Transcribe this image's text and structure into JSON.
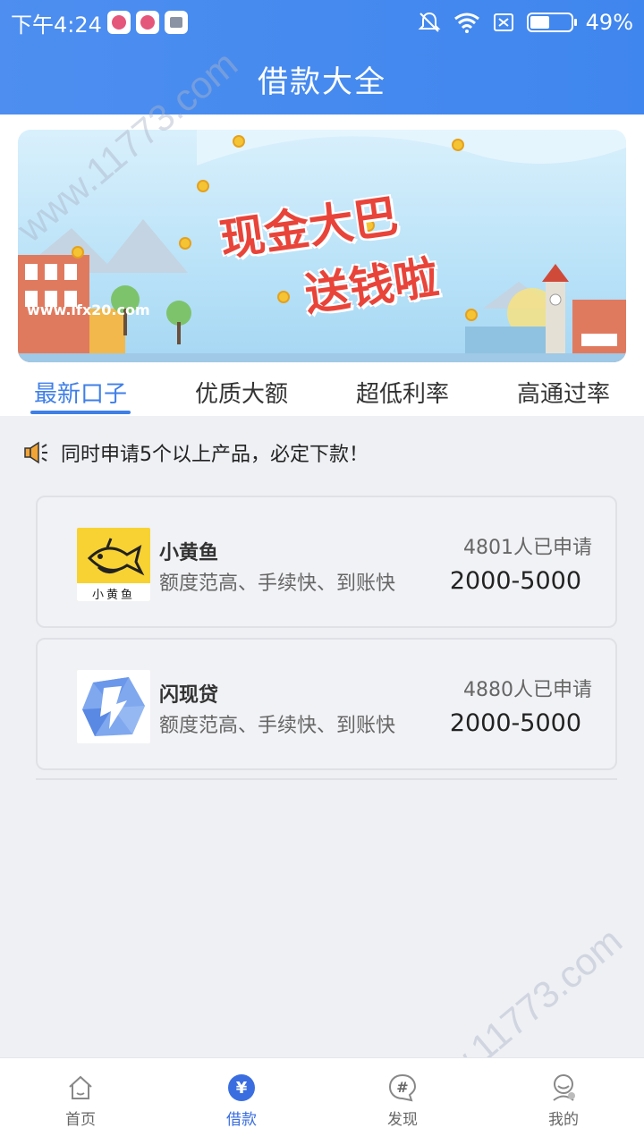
{
  "status_bar": {
    "time": "下午4:24",
    "battery": "49%",
    "battery_level": 0.49
  },
  "header": {
    "title": "借款大全"
  },
  "banner": {
    "headline_1": "现金大巴",
    "headline_2": "送钱啦",
    "url_text": "www.lfx20.com"
  },
  "tabs": [
    {
      "label": "最新口子",
      "active": true
    },
    {
      "label": "优质大额",
      "active": false
    },
    {
      "label": "超低利率",
      "active": false
    },
    {
      "label": "高通过率",
      "active": false
    }
  ],
  "notice": {
    "text": "同时申请5个以上产品，必定下款！"
  },
  "products": [
    {
      "name": "小黄鱼",
      "logo_caption": "小黄鱼",
      "description": "额度范高、手续快、到账快",
      "applicants": "4801人已申请",
      "amount_range": "2000-5000",
      "logo_color": "#f7d232"
    },
    {
      "name": "闪现贷",
      "description": "额度范高、手续快、到账快",
      "applicants": "4880人已申请",
      "amount_range": "2000-5000",
      "logo_color": "#5b8fe8"
    }
  ],
  "tabbar": [
    {
      "label": "首页",
      "icon": "home-icon",
      "active": false
    },
    {
      "label": "借款",
      "icon": "yen-icon",
      "active": true
    },
    {
      "label": "发现",
      "icon": "hashtag-chat-icon",
      "active": false
    },
    {
      "label": "我的",
      "icon": "user-icon",
      "active": false
    }
  ],
  "watermark": "www.11773.com",
  "colors": {
    "accent": "#3f7fe8",
    "header": "#4d8ef0"
  }
}
